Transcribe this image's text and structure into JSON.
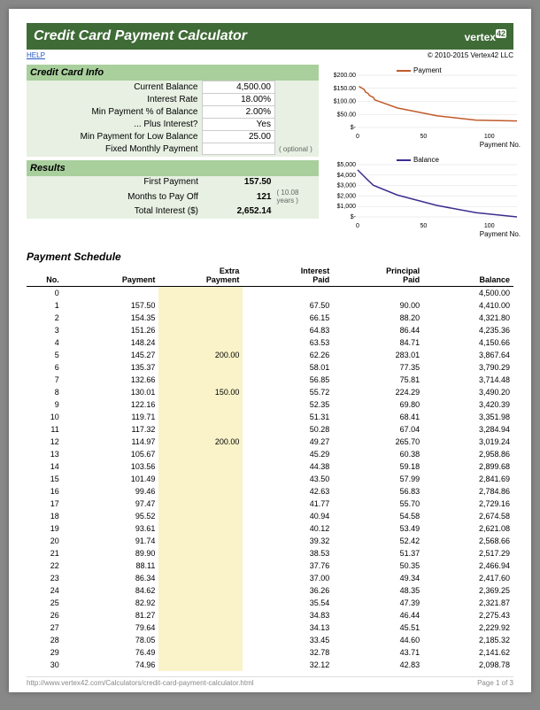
{
  "header": {
    "title": "Credit Card Payment Calculator",
    "brand": "vertex",
    "brand42": "42",
    "help": "HELP",
    "copyright": "© 2010-2015 Vertex42 LLC"
  },
  "info": {
    "section": "Credit Card Info",
    "rows": [
      {
        "label": "Current Balance",
        "value": "4,500.00"
      },
      {
        "label": "Interest Rate",
        "value": "18.00%"
      },
      {
        "label": "Min Payment % of Balance",
        "value": "2.00%"
      },
      {
        "label": "... Plus Interest?",
        "value": "Yes"
      },
      {
        "label": "Min Payment for Low Balance",
        "value": "25.00"
      },
      {
        "label": "Fixed Monthly Payment",
        "value": ""
      }
    ],
    "optional": "( optional )"
  },
  "results": {
    "section": "Results",
    "first_payment": {
      "label": "First Payment",
      "value": "157.50"
    },
    "months": {
      "label": "Months to Pay Off",
      "value": "121",
      "note": "( 10.08 years )"
    },
    "interest": {
      "label": "Total Interest ($)",
      "value": "2,652.14"
    }
  },
  "chart1": {
    "legend": "Payment",
    "color": "#c05a2a",
    "ylab0": "$-",
    "ylab1": "$50.00",
    "ylab2": "$100.00",
    "ylab3": "$150.00",
    "ylab4": "$200.00",
    "x0": "0",
    "x1": "50",
    "x2": "100",
    "xlabel": "Payment No."
  },
  "chart2": {
    "legend": "Balance",
    "color": "#3b2e8f",
    "ylab0": "$-",
    "ylab1": "$1,000",
    "ylab2": "$2,000",
    "ylab3": "$3,000",
    "ylab4": "$4,000",
    "ylab5": "$5,000",
    "x0": "0",
    "x1": "50",
    "x2": "100",
    "xlabel": "Payment No."
  },
  "schedule": {
    "title": "Payment Schedule",
    "cols": {
      "no": "No.",
      "payment": "Payment",
      "extra": "Extra\nPayment",
      "interest": "Interest\nPaid",
      "principal": "Principal\nPaid",
      "balance": "Balance"
    },
    "rows": [
      {
        "no": "0",
        "payment": "",
        "extra": "",
        "interest": "",
        "principal": "",
        "balance": "4,500.00"
      },
      {
        "no": "1",
        "payment": "157.50",
        "extra": "",
        "interest": "67.50",
        "principal": "90.00",
        "balance": "4,410.00"
      },
      {
        "no": "2",
        "payment": "154.35",
        "extra": "",
        "interest": "66.15",
        "principal": "88.20",
        "balance": "4,321.80"
      },
      {
        "no": "3",
        "payment": "151.26",
        "extra": "",
        "interest": "64.83",
        "principal": "86.44",
        "balance": "4,235.36"
      },
      {
        "no": "4",
        "payment": "148.24",
        "extra": "",
        "interest": "63.53",
        "principal": "84.71",
        "balance": "4,150.66"
      },
      {
        "no": "5",
        "payment": "145.27",
        "extra": "200.00",
        "interest": "62.26",
        "principal": "283.01",
        "balance": "3,867.64"
      },
      {
        "no": "6",
        "payment": "135.37",
        "extra": "",
        "interest": "58.01",
        "principal": "77.35",
        "balance": "3,790.29"
      },
      {
        "no": "7",
        "payment": "132.66",
        "extra": "",
        "interest": "56.85",
        "principal": "75.81",
        "balance": "3,714.48"
      },
      {
        "no": "8",
        "payment": "130.01",
        "extra": "150.00",
        "interest": "55.72",
        "principal": "224.29",
        "balance": "3,490.20"
      },
      {
        "no": "9",
        "payment": "122.16",
        "extra": "",
        "interest": "52.35",
        "principal": "69.80",
        "balance": "3,420.39"
      },
      {
        "no": "10",
        "payment": "119.71",
        "extra": "",
        "interest": "51.31",
        "principal": "68.41",
        "balance": "3,351.98"
      },
      {
        "no": "11",
        "payment": "117.32",
        "extra": "",
        "interest": "50.28",
        "principal": "67.04",
        "balance": "3,284.94"
      },
      {
        "no": "12",
        "payment": "114.97",
        "extra": "200.00",
        "interest": "49.27",
        "principal": "265.70",
        "balance": "3,019.24"
      },
      {
        "no": "13",
        "payment": "105.67",
        "extra": "",
        "interest": "45.29",
        "principal": "60.38",
        "balance": "2,958.86"
      },
      {
        "no": "14",
        "payment": "103.56",
        "extra": "",
        "interest": "44.38",
        "principal": "59.18",
        "balance": "2,899.68"
      },
      {
        "no": "15",
        "payment": "101.49",
        "extra": "",
        "interest": "43.50",
        "principal": "57.99",
        "balance": "2,841.69"
      },
      {
        "no": "16",
        "payment": "99.46",
        "extra": "",
        "interest": "42.63",
        "principal": "56.83",
        "balance": "2,784.86"
      },
      {
        "no": "17",
        "payment": "97.47",
        "extra": "",
        "interest": "41.77",
        "principal": "55.70",
        "balance": "2,729.16"
      },
      {
        "no": "18",
        "payment": "95.52",
        "extra": "",
        "interest": "40.94",
        "principal": "54.58",
        "balance": "2,674.58"
      },
      {
        "no": "19",
        "payment": "93.61",
        "extra": "",
        "interest": "40.12",
        "principal": "53.49",
        "balance": "2,621.08"
      },
      {
        "no": "20",
        "payment": "91.74",
        "extra": "",
        "interest": "39.32",
        "principal": "52.42",
        "balance": "2,568.66"
      },
      {
        "no": "21",
        "payment": "89.90",
        "extra": "",
        "interest": "38.53",
        "principal": "51.37",
        "balance": "2,517.29"
      },
      {
        "no": "22",
        "payment": "88.11",
        "extra": "",
        "interest": "37.76",
        "principal": "50.35",
        "balance": "2,466.94"
      },
      {
        "no": "23",
        "payment": "86.34",
        "extra": "",
        "interest": "37.00",
        "principal": "49.34",
        "balance": "2,417.60"
      },
      {
        "no": "24",
        "payment": "84.62",
        "extra": "",
        "interest": "36.26",
        "principal": "48.35",
        "balance": "2,369.25"
      },
      {
        "no": "25",
        "payment": "82.92",
        "extra": "",
        "interest": "35.54",
        "principal": "47.39",
        "balance": "2,321.87"
      },
      {
        "no": "26",
        "payment": "81.27",
        "extra": "",
        "interest": "34.83",
        "principal": "46.44",
        "balance": "2,275.43"
      },
      {
        "no": "27",
        "payment": "79.64",
        "extra": "",
        "interest": "34.13",
        "principal": "45.51",
        "balance": "2,229.92"
      },
      {
        "no": "28",
        "payment": "78.05",
        "extra": "",
        "interest": "33.45",
        "principal": "44.60",
        "balance": "2,185.32"
      },
      {
        "no": "29",
        "payment": "76.49",
        "extra": "",
        "interest": "32.78",
        "principal": "43.71",
        "balance": "2,141.62"
      },
      {
        "no": "30",
        "payment": "74.96",
        "extra": "",
        "interest": "32.12",
        "principal": "42.83",
        "balance": "2,098.78"
      }
    ]
  },
  "footer": {
    "url": "http://www.vertex42.com/Calculators/credit-card-payment-calculator.html",
    "page": "Page 1 of 3"
  },
  "chart_data": [
    {
      "type": "line",
      "title": "Payment",
      "xlabel": "Payment No.",
      "ylabel": "",
      "ylim": [
        0,
        200
      ],
      "series": [
        {
          "name": "Payment",
          "color": "#c05a2a",
          "x": [
            1,
            5,
            6,
            8,
            9,
            12,
            13,
            30,
            60,
            90,
            121
          ],
          "y": [
            157.5,
            145.27,
            135.37,
            130.01,
            122.16,
            114.97,
            105.67,
            74.96,
            45,
            28,
            25
          ]
        }
      ]
    },
    {
      "type": "line",
      "title": "Balance",
      "xlabel": "Payment No.",
      "ylabel": "",
      "ylim": [
        0,
        5000
      ],
      "series": [
        {
          "name": "Balance",
          "color": "#3b2e8f",
          "x": [
            0,
            5,
            8,
            12,
            30,
            60,
            90,
            121
          ],
          "y": [
            4500,
            3867.64,
            3490.2,
            3019.24,
            2098.78,
            1100,
            400,
            0
          ]
        }
      ]
    }
  ]
}
